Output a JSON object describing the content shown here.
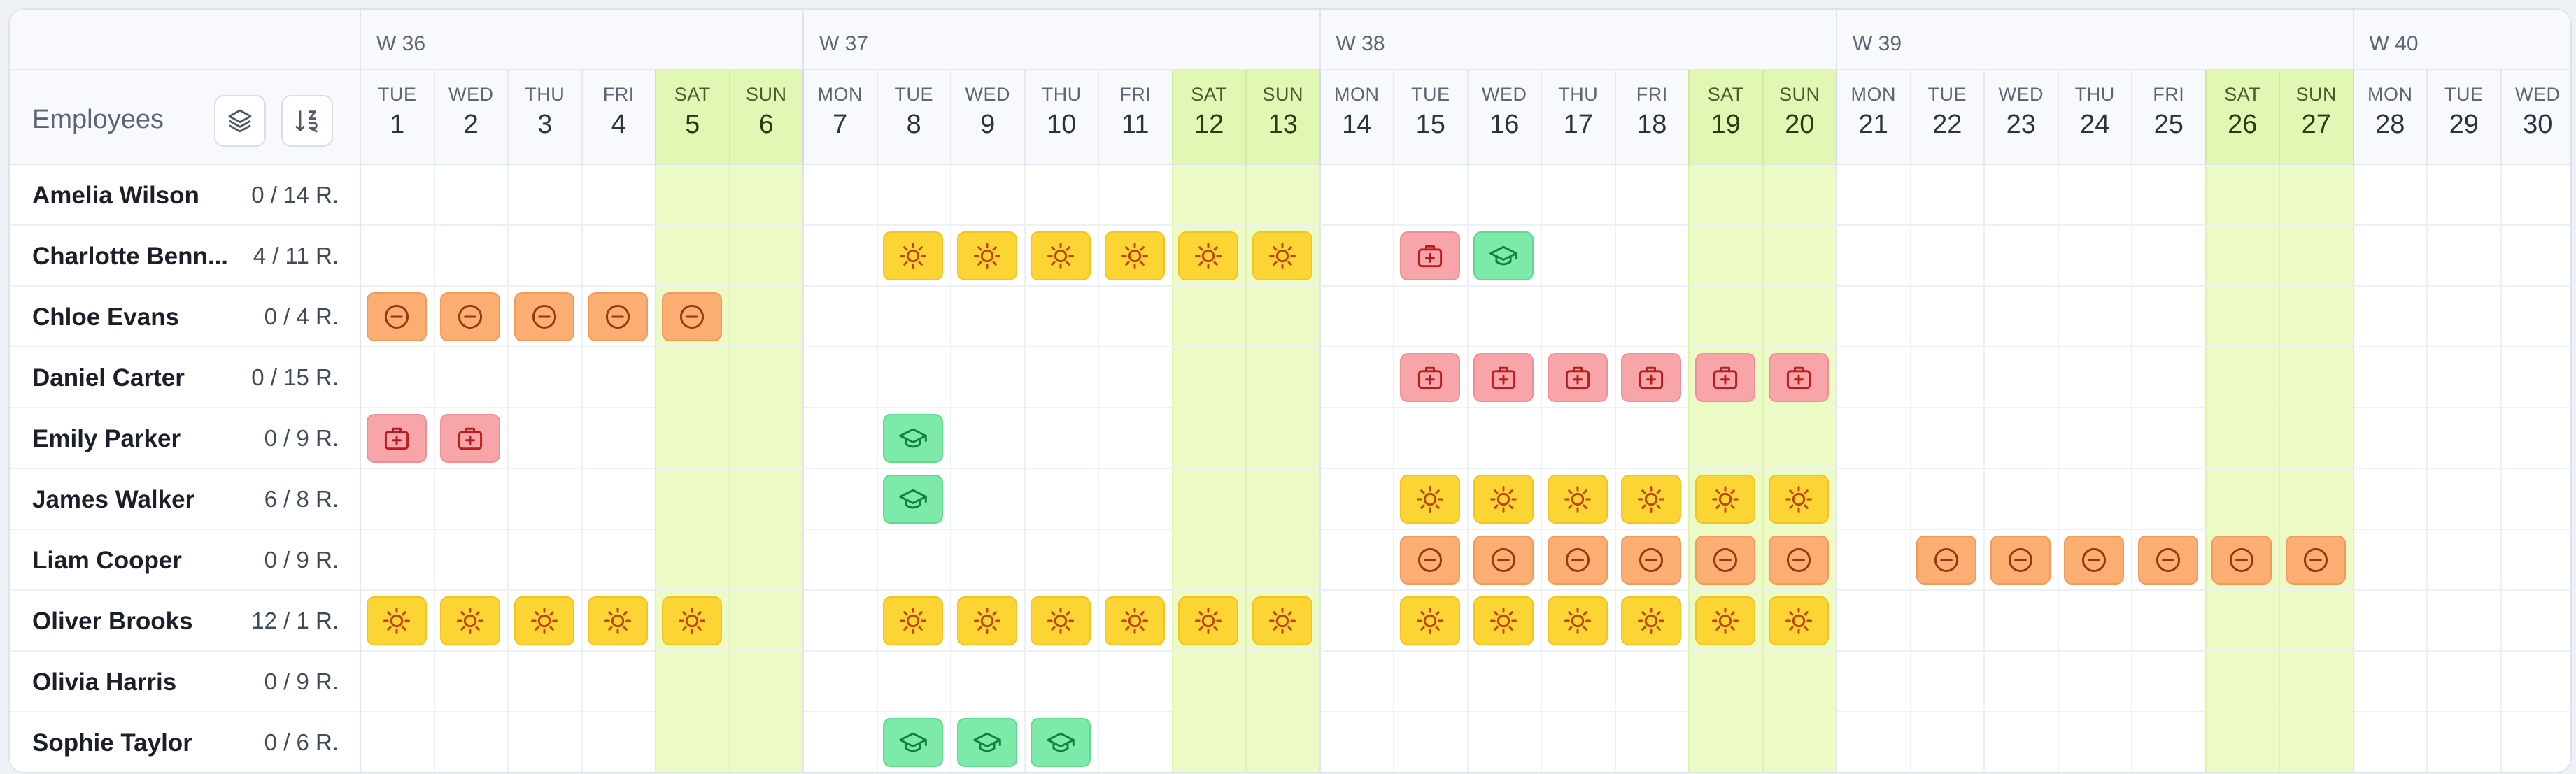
{
  "header": {
    "employees_label": "Employees",
    "layers_button_icon": "layers-icon",
    "sort_button_icon": "sort-numeric-icon"
  },
  "weeks": [
    {
      "label": "W 36",
      "days": 6
    },
    {
      "label": "W 37",
      "days": 7
    },
    {
      "label": "W 38",
      "days": 7
    },
    {
      "label": "W 39",
      "days": 7
    },
    {
      "label": "W 40",
      "days": 3
    }
  ],
  "days": [
    {
      "name": "TUE",
      "num": "1",
      "weekend": false
    },
    {
      "name": "WED",
      "num": "2",
      "weekend": false
    },
    {
      "name": "THU",
      "num": "3",
      "weekend": false
    },
    {
      "name": "FRI",
      "num": "4",
      "weekend": false
    },
    {
      "name": "SAT",
      "num": "5",
      "weekend": true
    },
    {
      "name": "SUN",
      "num": "6",
      "weekend": true
    },
    {
      "name": "MON",
      "num": "7",
      "weekend": false
    },
    {
      "name": "TUE",
      "num": "8",
      "weekend": false
    },
    {
      "name": "WED",
      "num": "9",
      "weekend": false
    },
    {
      "name": "THU",
      "num": "10",
      "weekend": false
    },
    {
      "name": "FRI",
      "num": "11",
      "weekend": false
    },
    {
      "name": "SAT",
      "num": "12",
      "weekend": true
    },
    {
      "name": "SUN",
      "num": "13",
      "weekend": true
    },
    {
      "name": "MON",
      "num": "14",
      "weekend": false
    },
    {
      "name": "TUE",
      "num": "15",
      "weekend": false
    },
    {
      "name": "WED",
      "num": "16",
      "weekend": false
    },
    {
      "name": "THU",
      "num": "17",
      "weekend": false
    },
    {
      "name": "FRI",
      "num": "18",
      "weekend": false
    },
    {
      "name": "SAT",
      "num": "19",
      "weekend": true
    },
    {
      "name": "SUN",
      "num": "20",
      "weekend": true
    },
    {
      "name": "MON",
      "num": "21",
      "weekend": false
    },
    {
      "name": "TUE",
      "num": "22",
      "weekend": false
    },
    {
      "name": "WED",
      "num": "23",
      "weekend": false
    },
    {
      "name": "THU",
      "num": "24",
      "weekend": false
    },
    {
      "name": "FRI",
      "num": "25",
      "weekend": false
    },
    {
      "name": "SAT",
      "num": "26",
      "weekend": true
    },
    {
      "name": "SUN",
      "num": "27",
      "weekend": true
    },
    {
      "name": "MON",
      "num": "28",
      "weekend": false
    },
    {
      "name": "TUE",
      "num": "29",
      "weekend": false
    },
    {
      "name": "WED",
      "num": "30",
      "weekend": false
    }
  ],
  "absence_types": {
    "vacation": {
      "icon": "sun-icon",
      "color": "#fcd535"
    },
    "absent": {
      "icon": "minus-circle-icon",
      "color": "#fbae72"
    },
    "sick": {
      "icon": "first-aid-kit-icon",
      "color": "#f7a5a9"
    },
    "training": {
      "icon": "graduation-cap-icon",
      "color": "#7eeaa9"
    }
  },
  "employees": [
    {
      "name": "Amelia Wilson",
      "count": "0 / 14 R.",
      "entries": []
    },
    {
      "name": "Charlotte Benn...",
      "count": "4 / 11 R.",
      "entries": [
        {
          "day": 8,
          "type": "vacation"
        },
        {
          "day": 9,
          "type": "vacation"
        },
        {
          "day": 10,
          "type": "vacation"
        },
        {
          "day": 11,
          "type": "vacation"
        },
        {
          "day": 12,
          "type": "vacation"
        },
        {
          "day": 13,
          "type": "vacation"
        },
        {
          "day": 15,
          "type": "sick"
        },
        {
          "day": 16,
          "type": "training"
        }
      ]
    },
    {
      "name": "Chloe Evans",
      "count": "0 / 4 R.",
      "entries": [
        {
          "day": 1,
          "type": "absent"
        },
        {
          "day": 2,
          "type": "absent"
        },
        {
          "day": 3,
          "type": "absent"
        },
        {
          "day": 4,
          "type": "absent"
        },
        {
          "day": 5,
          "type": "absent"
        }
      ]
    },
    {
      "name": "Daniel Carter",
      "count": "0 / 15 R.",
      "entries": [
        {
          "day": 15,
          "type": "sick"
        },
        {
          "day": 16,
          "type": "sick"
        },
        {
          "day": 17,
          "type": "sick"
        },
        {
          "day": 18,
          "type": "sick"
        },
        {
          "day": 19,
          "type": "sick"
        },
        {
          "day": 20,
          "type": "sick"
        }
      ]
    },
    {
      "name": "Emily Parker",
      "count": "0 / 9 R.",
      "entries": [
        {
          "day": 1,
          "type": "sick"
        },
        {
          "day": 2,
          "type": "sick"
        },
        {
          "day": 8,
          "type": "training"
        }
      ]
    },
    {
      "name": "James Walker",
      "count": "6 / 8 R.",
      "entries": [
        {
          "day": 8,
          "type": "training"
        },
        {
          "day": 15,
          "type": "vacation"
        },
        {
          "day": 16,
          "type": "vacation"
        },
        {
          "day": 17,
          "type": "vacation"
        },
        {
          "day": 18,
          "type": "vacation"
        },
        {
          "day": 19,
          "type": "vacation"
        },
        {
          "day": 20,
          "type": "vacation"
        }
      ]
    },
    {
      "name": "Liam Cooper",
      "count": "0 / 9 R.",
      "entries": [
        {
          "day": 15,
          "type": "absent"
        },
        {
          "day": 16,
          "type": "absent"
        },
        {
          "day": 17,
          "type": "absent"
        },
        {
          "day": 18,
          "type": "absent"
        },
        {
          "day": 19,
          "type": "absent"
        },
        {
          "day": 20,
          "type": "absent"
        },
        {
          "day": 22,
          "type": "absent"
        },
        {
          "day": 23,
          "type": "absent"
        },
        {
          "day": 24,
          "type": "absent"
        },
        {
          "day": 25,
          "type": "absent"
        },
        {
          "day": 26,
          "type": "absent"
        },
        {
          "day": 27,
          "type": "absent"
        }
      ]
    },
    {
      "name": "Oliver Brooks",
      "count": "12 / 1 R.",
      "entries": [
        {
          "day": 1,
          "type": "vacation"
        },
        {
          "day": 2,
          "type": "vacation"
        },
        {
          "day": 3,
          "type": "vacation"
        },
        {
          "day": 4,
          "type": "vacation"
        },
        {
          "day": 5,
          "type": "vacation"
        },
        {
          "day": 8,
          "type": "vacation"
        },
        {
          "day": 9,
          "type": "vacation"
        },
        {
          "day": 10,
          "type": "vacation"
        },
        {
          "day": 11,
          "type": "vacation"
        },
        {
          "day": 12,
          "type": "vacation"
        },
        {
          "day": 13,
          "type": "vacation"
        },
        {
          "day": 15,
          "type": "vacation"
        },
        {
          "day": 16,
          "type": "vacation"
        },
        {
          "day": 17,
          "type": "vacation"
        },
        {
          "day": 18,
          "type": "vacation"
        },
        {
          "day": 19,
          "type": "vacation"
        },
        {
          "day": 20,
          "type": "vacation"
        }
      ]
    },
    {
      "name": "Olivia Harris",
      "count": "0 / 9 R.",
      "entries": []
    },
    {
      "name": "Sophie Taylor",
      "count": "0 / 6 R.",
      "entries": [
        {
          "day": 8,
          "type": "training"
        },
        {
          "day": 9,
          "type": "training"
        },
        {
          "day": 10,
          "type": "training"
        }
      ]
    }
  ]
}
